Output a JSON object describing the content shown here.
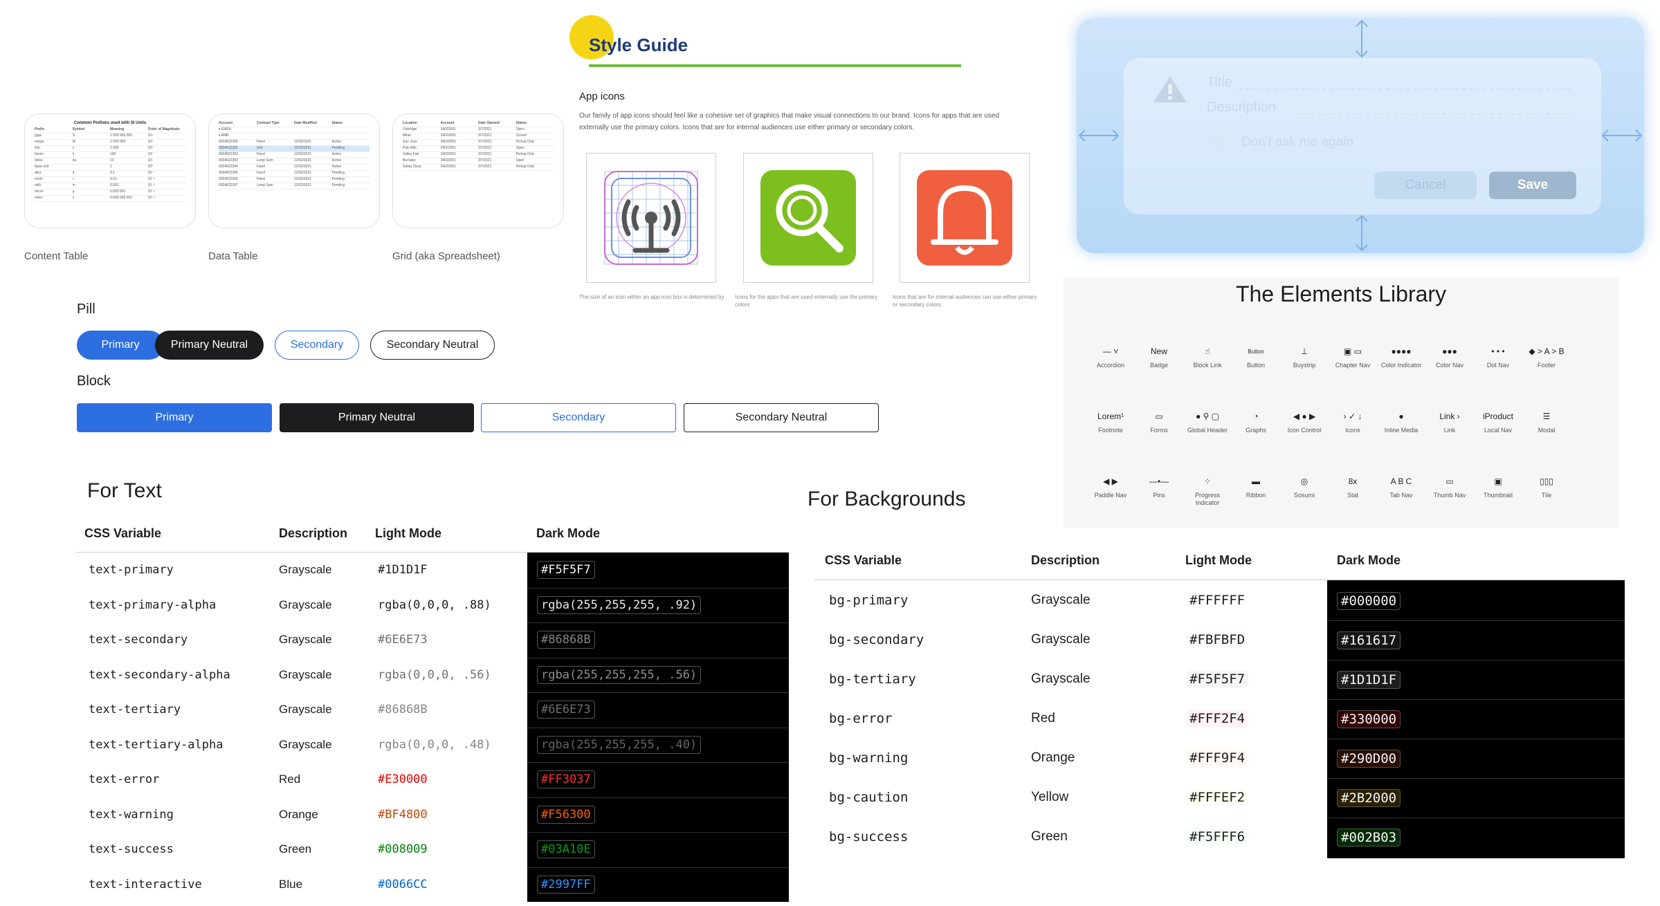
{
  "thumbnails": [
    {
      "label": "Content Table",
      "title": "Common Prefixes used with SI Units",
      "rows": [
        [
          "Prefix",
          "Symbol",
          "Meaning",
          "Order of Magnitude"
        ],
        [
          "giga-",
          "G",
          "1 000 000 000",
          "10⁹"
        ],
        [
          "mega-",
          "M",
          "1 000 000",
          "10⁶"
        ],
        [
          "kilo-",
          "k",
          "1 000",
          "10³"
        ],
        [
          "hecto-",
          "h",
          "100",
          "10²"
        ],
        [
          "deka-",
          "da",
          "10",
          "10¹"
        ],
        [
          "base unit",
          "",
          "1",
          "10⁰"
        ],
        [
          "deci-",
          "d",
          "0.1",
          "10⁻¹"
        ],
        [
          "centi-",
          "c",
          "0.01",
          "10⁻²"
        ],
        [
          "milli-",
          "m",
          "0.001",
          "10⁻³"
        ],
        [
          "micro-",
          "µ",
          "0.000 001",
          "10⁻⁶"
        ],
        [
          "nano-",
          "n",
          "0.000 000 001",
          "10⁻⁹"
        ]
      ]
    },
    {
      "label": "Data Table",
      "rows": [
        [
          "Account",
          "Contract Type",
          "Date Modified",
          "Status"
        ],
        [
          "▾ EMEA",
          "",
          "",
          ""
        ],
        [
          "▾ AMR",
          "",
          "",
          ""
        ],
        [
          "0034622390",
          "Fixed",
          "12/02/2021",
          "Active"
        ],
        [
          "0034622391",
          "Unit",
          "12/02/2021",
          "Pending"
        ],
        [
          "0034622392",
          "Fixed",
          "12/02/2021",
          "Active"
        ],
        [
          "0034622393",
          "Lump Sum",
          "12/02/2021",
          "Active"
        ],
        [
          "0034622394",
          "Fixed",
          "12/02/2021",
          "Active"
        ],
        [
          "0034622395",
          "Fixed",
          "12/02/2021",
          "Pending"
        ],
        [
          "0034622396",
          "Fixed",
          "12/02/2021",
          "Pending"
        ],
        [
          "0034622397",
          "Lump Sum",
          "12/02/2021",
          "Pending"
        ]
      ]
    },
    {
      "label": "Grid (aka Spreadsheet)",
      "rows": [
        [
          "Location",
          "Account",
          "Date Opened",
          "Status"
        ],
        [
          "Oakridge",
          "34022091",
          "3/7/2021",
          "Open"
        ],
        [
          "Milan",
          "34022091",
          "3/7/2021",
          "Closed"
        ],
        [
          "San Jose",
          "34022091",
          "3/7/2021",
          "Pickup Only"
        ],
        [
          "Palo Alto",
          "34022091",
          "3/7/2021",
          "Open"
        ],
        [
          "Valley Fair",
          "34022091",
          "3/7/2021",
          "Pickup Only"
        ],
        [
          "Burnaby",
          "34022091",
          "3/7/2021",
          "Open"
        ],
        [
          "Santa Clara",
          "34022091",
          "3/7/2021",
          "Pickup Only"
        ]
      ]
    }
  ],
  "pill": {
    "label": "Pill",
    "buttons": [
      "Primary",
      "Primary Neutral",
      "Secondary",
      "Secondary Neutral"
    ]
  },
  "block": {
    "label": "Block",
    "buttons": [
      "Primary",
      "Primary Neutral",
      "Secondary",
      "Secondary Neutral"
    ]
  },
  "text_table": {
    "title": "For Text",
    "headers": [
      "CSS Variable",
      "Description",
      "Light Mode",
      "Dark Mode"
    ],
    "rows": [
      {
        "var": "text-primary",
        "desc": "Grayscale",
        "light": "#1D1D1F",
        "dark": "#F5F5F7",
        "light_color": "#1d1d1f",
        "dark_color": "#f5f5f7"
      },
      {
        "var": "text-primary-alpha",
        "desc": "Grayscale",
        "light": "rgba(0,0,0, .88)",
        "dark": "rgba(255,255,255, .92)",
        "light_color": "#1d1d1f",
        "dark_color": "#ebebeb"
      },
      {
        "var": "text-secondary",
        "desc": "Grayscale",
        "light": "#6E6E73",
        "dark": "#86868B",
        "light_color": "#6e6e73",
        "dark_color": "#86868b"
      },
      {
        "var": "text-secondary-alpha",
        "desc": "Grayscale",
        "light": "rgba(0,0,0, .56)",
        "dark": "rgba(255,255,255, .56)",
        "light_color": "#707070",
        "dark_color": "#8f8f8f"
      },
      {
        "var": "text-tertiary",
        "desc": "Grayscale",
        "light": "#86868B",
        "dark": "#6E6E73",
        "light_color": "#86868b",
        "dark_color": "#6e6e73"
      },
      {
        "var": "text-tertiary-alpha",
        "desc": "Grayscale",
        "light": "rgba(0,0,0, .48)",
        "dark": "rgba(255,255,255, .40)",
        "light_color": "#858585",
        "dark_color": "#666666"
      },
      {
        "var": "text-error",
        "desc": "Red",
        "light": "#E30000",
        "dark": "#FF3037",
        "light_color": "#e30000",
        "dark_color": "#ff3037"
      },
      {
        "var": "text-warning",
        "desc": "Orange",
        "light": "#BF4800",
        "dark": "#F56300",
        "light_color": "#bf4800",
        "dark_color": "#f56300"
      },
      {
        "var": "text-success",
        "desc": "Green",
        "light": "#008009",
        "dark": "#03A10E",
        "light_color": "#008009",
        "dark_color": "#03a10e"
      },
      {
        "var": "text-interactive",
        "desc": "Blue",
        "light": "#0066CC",
        "dark": "#2997FF",
        "light_color": "#0066cc",
        "dark_color": "#2997ff"
      }
    ]
  },
  "bg_table": {
    "title": "For Backgrounds",
    "headers": [
      "CSS Variable",
      "Description",
      "Light Mode",
      "Dark Mode"
    ],
    "rows": [
      {
        "var": "bg-primary",
        "desc": "Grayscale",
        "light": "#FFFFFF",
        "dark": "#000000",
        "light_bg": "#ffffff",
        "dark_bg": "#000000"
      },
      {
        "var": "bg-secondary",
        "desc": "Grayscale",
        "light": "#FBFBFD",
        "dark": "#161617",
        "light_bg": "#fbfbfd",
        "dark_bg": "#161617"
      },
      {
        "var": "bg-tertiary",
        "desc": "Grayscale",
        "light": "#F5F5F7",
        "dark": "#1D1D1F",
        "light_bg": "#f5f5f7",
        "dark_bg": "#1d1d1f"
      },
      {
        "var": "bg-error",
        "desc": "Red",
        "light": "#FFF2F4",
        "dark": "#330000",
        "light_bg": "#fff2f4",
        "dark_bg": "#330000"
      },
      {
        "var": "bg-warning",
        "desc": "Orange",
        "light": "#FFF9F4",
        "dark": "#290D00",
        "light_bg": "#fff9f4",
        "dark_bg": "#290d00"
      },
      {
        "var": "bg-caution",
        "desc": "Yellow",
        "light": "#FFFEF2",
        "dark": "#2B2000",
        "light_bg": "#fffef2",
        "dark_bg": "#2b2000"
      },
      {
        "var": "bg-success",
        "desc": "Green",
        "light": "#F5FFF6",
        "dark": "#002B03",
        "light_bg": "#f5fff6",
        "dark_bg": "#002b03"
      }
    ]
  },
  "style_guide": {
    "title": "Style Guide",
    "section": "App icons",
    "body": "Our family of app icons should feel like a cohesive set of graphics that make visual connections to our brand. Icons for apps that are used externally use the primary colors. Icons that are for internal audiences use either primary or secondary colors.",
    "captions": [
      "The size of an icon within an app icon box is determined by",
      "Icons for the apps that are used externally use the primary colors",
      "Icons that are for internal audiences can use either primary or secondary colors."
    ],
    "icons": [
      "broadcast-grid-icon",
      "search-app-icon",
      "bell-app-icon"
    ],
    "colors": {
      "accent_circle": "#f5d416",
      "rule": "#6bbf3a",
      "title": "#1d3a7a",
      "search_bg": "#7cbf1e",
      "bell_bg": "#f06040"
    }
  },
  "dialog": {
    "title": "Title",
    "description": "Description",
    "checkbox": "Don't ask me again",
    "cancel": "Cancel",
    "save": "Save",
    "icon": "warning-icon"
  },
  "elements_library": {
    "title": "The Elements Library",
    "items": [
      {
        "label": "Accordion",
        "glyph": "— ˅"
      },
      {
        "label": "Badge",
        "glyph": "New"
      },
      {
        "label": "Block Link",
        "glyph": "☝"
      },
      {
        "label": "Button",
        "glyph": "Button"
      },
      {
        "label": "Buystrip",
        "glyph": "⊥"
      },
      {
        "label": "Chapter Nav",
        "glyph": "▣ ▭"
      },
      {
        "label": "Color Indicator",
        "glyph": "●●●●"
      },
      {
        "label": "Color Nav",
        "glyph": "●●●"
      },
      {
        "label": "Dot Nav",
        "glyph": "• • •"
      },
      {
        "label": "Footer",
        "glyph": "◆ > A > B"
      },
      {
        "label": "Footnote",
        "glyph": "Lorem¹"
      },
      {
        "label": "Forms",
        "glyph": "▭"
      },
      {
        "label": "Global Header",
        "glyph": "● ⚲ ▢"
      },
      {
        "label": "Graphs",
        "glyph": "◔"
      },
      {
        "label": "Icon Control",
        "glyph": "◀ ● ▶"
      },
      {
        "label": "Icons",
        "glyph": "› ✓ ↓"
      },
      {
        "label": "Inline Media",
        "glyph": "●"
      },
      {
        "label": "Link",
        "glyph": "Link ›"
      },
      {
        "label": "Local Nav",
        "glyph": "iProduct"
      },
      {
        "label": "Modal",
        "glyph": "☰"
      },
      {
        "label": "Paddle Nav",
        "glyph": "◀ ▶"
      },
      {
        "label": "Pins",
        "glyph": "—•—"
      },
      {
        "label": "Progress Indicator",
        "glyph": "⁘"
      },
      {
        "label": "Ribbon",
        "glyph": "▬"
      },
      {
        "label": "Sosumi",
        "glyph": "◎"
      },
      {
        "label": "Stat",
        "glyph": "8x"
      },
      {
        "label": "Tab Nav",
        "glyph": "A B C"
      },
      {
        "label": "Thumb Nav",
        "glyph": "▭"
      },
      {
        "label": "Thumbnail",
        "glyph": "▣"
      },
      {
        "label": "Tile",
        "glyph": "▯▯▯"
      }
    ]
  }
}
